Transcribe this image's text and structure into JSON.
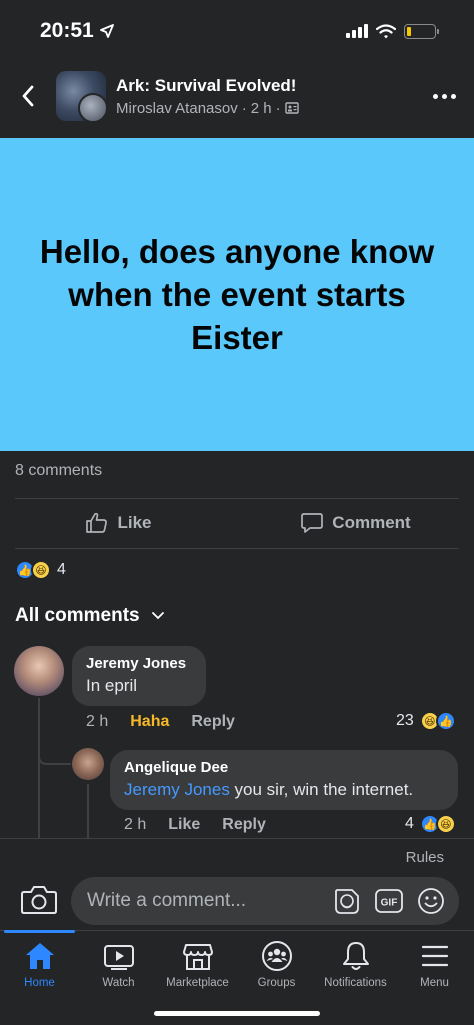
{
  "status_bar": {
    "time": "20:51"
  },
  "header": {
    "group_name": "Ark: Survival Evolved!",
    "author": "Miroslav Atanasov",
    "time_ago": "2 h",
    "separator": "·"
  },
  "post": {
    "text": "Hello, does anyone know when the event starts Eister",
    "background_color": "#5ac8fa"
  },
  "stats": {
    "comments_count": "8 comments",
    "reaction_count": "4"
  },
  "actions": {
    "like": "Like",
    "comment": "Comment"
  },
  "comments_filter": {
    "label": "All comments"
  },
  "comments": [
    {
      "author": "Jeremy Jones",
      "text": "In epril",
      "time_ago": "2 h",
      "reaction_label": "Haha",
      "reply_label": "Reply",
      "reaction_count": "23"
    },
    {
      "author": "Angelique Dee",
      "mention": "Jeremy Jones",
      "text": " you sir, win the internet.",
      "time_ago": "2 h",
      "like_label": "Like",
      "reply_label": "Reply",
      "reaction_count": "4"
    }
  ],
  "composer": {
    "rules": "Rules",
    "placeholder": "Write a comment...",
    "gif_label": "GIF"
  },
  "tabs": [
    {
      "label": "Home",
      "icon": "home-icon",
      "active": true
    },
    {
      "label": "Watch",
      "icon": "watch-icon"
    },
    {
      "label": "Marketplace",
      "icon": "marketplace-icon"
    },
    {
      "label": "Groups",
      "icon": "groups-icon"
    },
    {
      "label": "Notifications",
      "icon": "bell-icon"
    },
    {
      "label": "Menu",
      "icon": "menu-icon"
    }
  ],
  "colors": {
    "accent": "#2d88ff",
    "haha": "#f7b928",
    "mention": "#4599ff"
  }
}
